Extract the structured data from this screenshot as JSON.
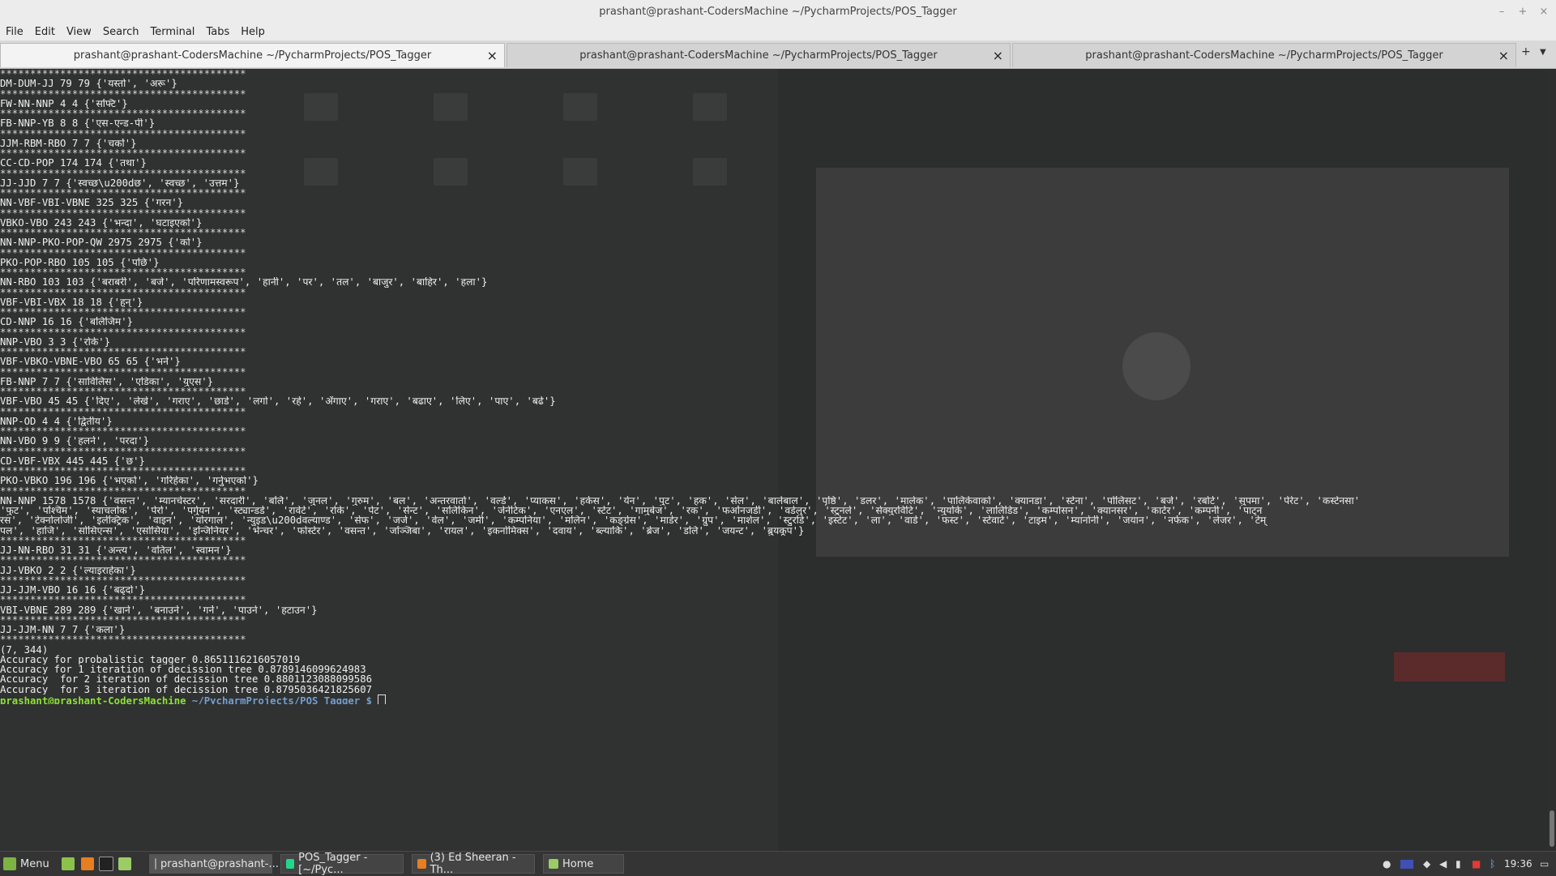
{
  "window": {
    "title": "prashant@prashant-CodersMachine ~/PycharmProjects/POS_Tagger",
    "controls": [
      "–",
      "+",
      "×"
    ]
  },
  "menu": [
    "File",
    "Edit",
    "View",
    "Search",
    "Terminal",
    "Tabs",
    "Help"
  ],
  "tabs": [
    {
      "label": "prashant@prashant-CodersMachine ~/PycharmProjects/POS_Tagger",
      "active": true
    },
    {
      "label": "prashant@prashant-CodersMachine ~/PycharmProjects/POS_Tagger",
      "active": false
    },
    {
      "label": "prashant@prashant-CodersMachine ~/PycharmProjects/POS_Tagger",
      "active": false
    }
  ],
  "tab_close": "×",
  "tab_new": "+",
  "tab_menu": "▼",
  "terminal": {
    "lines": [
      "*****************************************",
      "DM-DUM-JJ 79 79 {'यस्तो', 'अरू'}",
      "*****************************************",
      "FW-NN-NNP 4 4 {'सफ्टि'}",
      "*****************************************",
      "FB-NNP-YB 8 8 {'एस-एन्ड-पी'}",
      "*****************************************",
      "JJM-RBM-RBO 7 7 {'चर्को'}",
      "*****************************************",
      "CC-CD-POP 174 174 {'तथा'}",
      "*****************************************",
      "JJ-JJD 7 7 {'स्वच्छ\\u200dछ', 'स्वच्छ', 'उत्तम'}",
      "*****************************************",
      "NN-VBF-VBI-VBNE 325 325 {'गरन'}",
      "*****************************************",
      "VBKO-VBO 243 243 {'भन्दा', 'घटाइएको'}",
      "*****************************************",
      "NN-NNP-PKO-POP-QW 2975 2975 {'को'}",
      "*****************************************",
      "PKO-POP-RBO 105 105 {'पछि'}",
      "*****************************************",
      "NN-RBO 103 103 {'बराबरी', 'बजे', 'परिणामस्वरूप', 'हानी', 'पर', 'तल', 'बाजुर', 'बाहिर', 'हला'}",
      "*****************************************",
      "VBF-VBI-VBX 18 18 {'हुन्'}",
      "*****************************************",
      "CD-NNP 16 16 {'बलिजिम'}",
      "*****************************************",
      "NNP-VBO 3 3 {'रोके'}",
      "*****************************************",
      "VBF-VBKO-VBNE-VBO 65 65 {'भने'}",
      "*****************************************",
      "FB-NNP 7 7 {'साविलिस', 'एडिका', 'युएस'}",
      "*****************************************",
      "VBF-VBO 45 45 {'दिए', 'लेखे', 'गराए', 'छाडे', 'लगो', 'रहे', 'अँगाए', 'गराए', 'बढाए', 'लिए', 'पाए', 'बढे'}",
      "*****************************************",
      "NNP-OD 4 4 {'द्वितीय'}",
      "*****************************************",
      "NN-VBO 9 9 {'हलने', 'परदा'}",
      "*****************************************",
      "CD-VBF-VBX 445 445 {'छ'}",
      "*****************************************",
      "PKO-VBKO 196 196 {'भएको', 'गरिहेका', 'गर्नुभएको'}",
      "*****************************************",
      "NN-NNP 1578 1578 {'वसन्त', 'म्यानचेस्टर', 'सरदारी', 'बलि', 'जुनल', 'गुरुम', 'बल', 'अन्तरवार्ता', 'वर्ल्ड', 'प्याकस', 'हर्कस', 'येन', 'पुट', 'हक', 'सेल', 'बालेबाल', 'पृष्ठि', 'डलर', 'मालेक', 'पालिकेवाको', 'क्यानडा', 'स्टेना', 'पोलिसट', 'बजे', 'रबोर्ट', 'सुपमा', 'पेरेट', 'कस्टेनसा'",
      "'फुट', 'पश्चिम', 'स्याचलोक', 'पेरो', 'पर्गुयन', 'स्ट्यान्डर्ड', 'रावेटे', 'रोके', 'पेट', 'सेन्ट', 'सलिकिन', 'जेनेटिक', 'एनएल', 'स्टेट', 'गामुबेज', 'रक', 'फर्ओनजर्डी', 'वर्डलुर', 'स्टुनले', 'सेक्युरविटि', 'न्युयोर्क', 'लालिडिड', 'कम्पोसन', 'क्यानसर', 'कार्टर', 'कम्पनी', 'पाट्न",
      "रस', 'टेक्नोलोजी', 'इलेक्ट्रिक', 'वाइन', 'योरगाल', 'न्युइड\\u200dवल्याण्ड', 'सेफ', 'जर्ज', 'वेल', 'जमी', 'कम्पनिया', 'मलिन', 'कङ्ग्रेस', 'माडेर', 'ग्रुप', 'मार्शल', 'स्टुरडि', 'इस्टेट', 'ला', 'वार्ड', 'फस्ट', 'स्टेवार्ट', 'टाइम', 'म्यानोनी', 'जयान', 'नर्फक', 'लेजर', 'टेम्",
      "पल', 'हाजि', 'सोसिएन्स', 'एसोसिया', 'इन्जिनियर', 'भेन्चर', 'फोर्स्टर', 'वसन्त', 'जञ्जिबा', 'रायल', 'इकनोमिक्स', 'दवाय', 'ब्ल्याकि', 'ब्रेज', 'डलि', 'जयन्ट', 'ब्रुयकूप'}",
      "*****************************************",
      "JJ-NN-RBO 31 31 {'अन्त्य', 'वतिल', 'स्वामन'}",
      "*****************************************",
      "JJ-VBKO 2 2 {'ल्याइराहेका'}",
      "*****************************************",
      "JJ-JJM-VBO 16 16 {'बढ्दो'}",
      "*****************************************",
      "VBI-VBNE 289 289 {'खाने', 'बनाउने', 'गर्ने', 'पाउने', 'हटाउन'}",
      "*****************************************",
      "JJ-JJM-NN 7 7 {'कला'}",
      "*****************************************",
      "(7, 344)",
      "Accuracy for probalistic tagger 0.8651116216057019",
      "Accuracy for 1 iteration of decission tree 0.8789146099624983",
      "Accuracy  for 2 iteration of decission tree 0.8801123088099586",
      "Accuracy  for 3 iteration of decission tree 0.8795036421825607"
    ],
    "prompt_user": "prashant@prashant-CodersMachine",
    "prompt_path": "~/PycharmProjects/POS_Tagger $"
  },
  "taskbar": {
    "menu_label": "Menu",
    "tasks": [
      {
        "label": "prashant@prashant-...",
        "icon": "terminal-icon",
        "active": true
      },
      {
        "label": "POS_Tagger - [~/Pyc...",
        "icon": "pycharm-icon",
        "active": false
      },
      {
        "label": "(3) Ed Sheeran - Th...",
        "icon": "firefox-icon",
        "active": false
      },
      {
        "label": "Home",
        "icon": "folder-icon",
        "active": false
      }
    ],
    "clock": "19:36"
  },
  "colors": {
    "prompt_user": "#8ae234",
    "prompt_path": "#729fcf",
    "terminal_bg": "#2e2e2e"
  }
}
